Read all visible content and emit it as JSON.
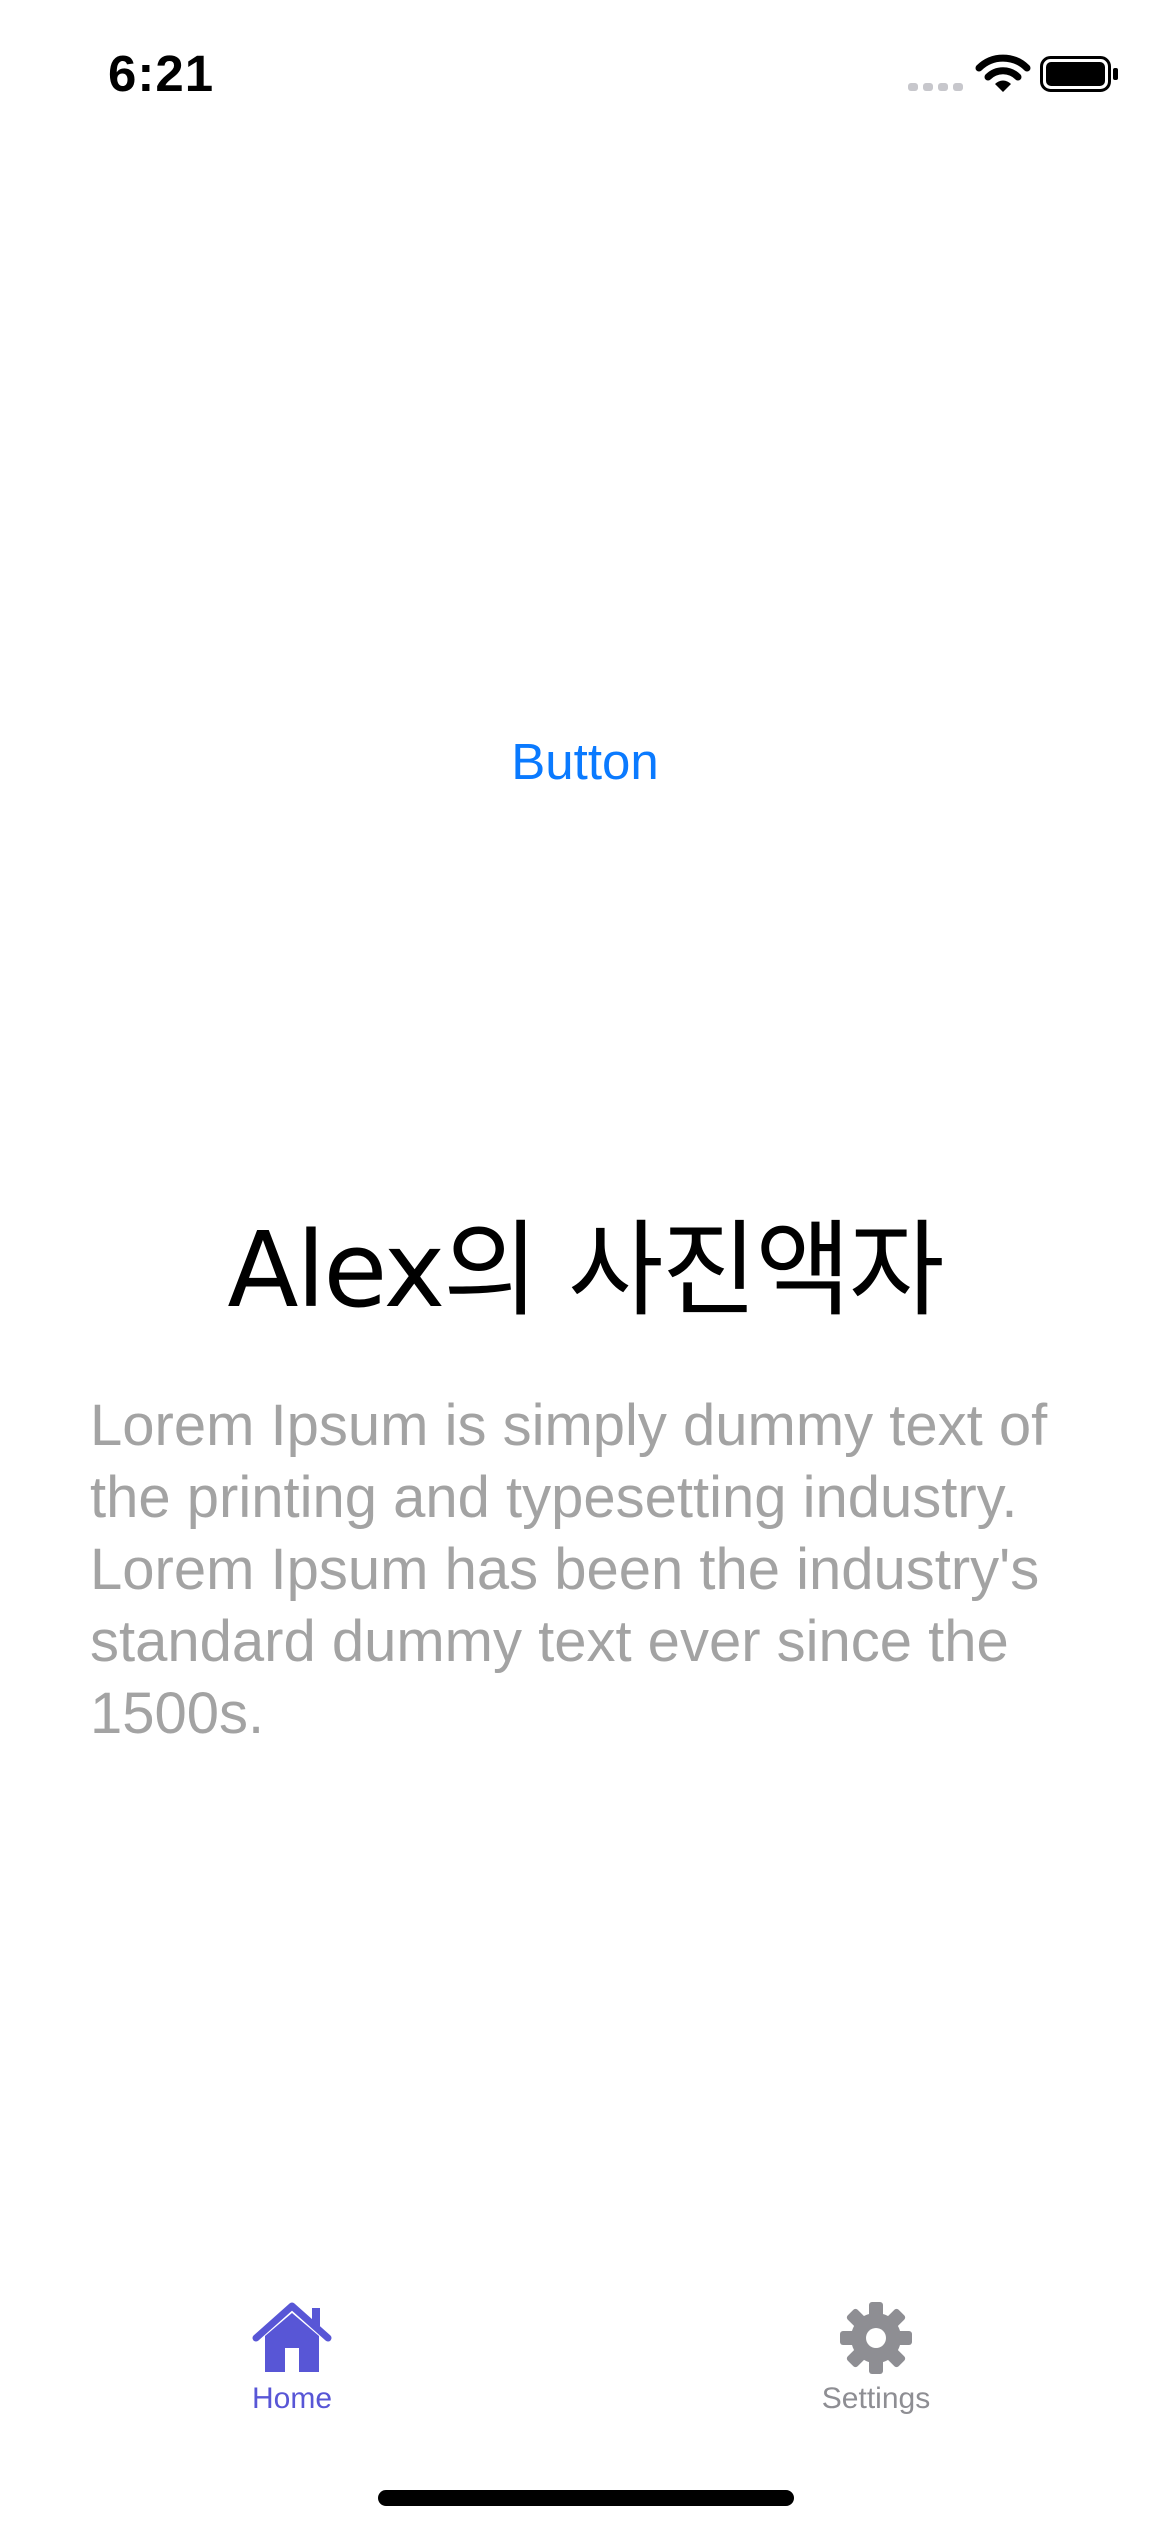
{
  "status_bar": {
    "time": "6:21"
  },
  "main": {
    "button_label": "Button",
    "title": "Alex의 사진액자",
    "body_text": "Lorem Ipsum is simply dummy text of the printing and typesetting industry. Lorem Ipsum has been the industry's standard dummy text ever since the 1500s."
  },
  "tab_bar": {
    "tabs": [
      {
        "label": "Home",
        "icon": "house-icon",
        "selected": true
      },
      {
        "label": "Settings",
        "icon": "gear-icon",
        "selected": false
      }
    ]
  },
  "colors": {
    "accent": "#5856D6",
    "button_blue": "#0A7AFF",
    "secondary_text": "#A3A3A3",
    "inactive_tab": "#8E8E93"
  }
}
